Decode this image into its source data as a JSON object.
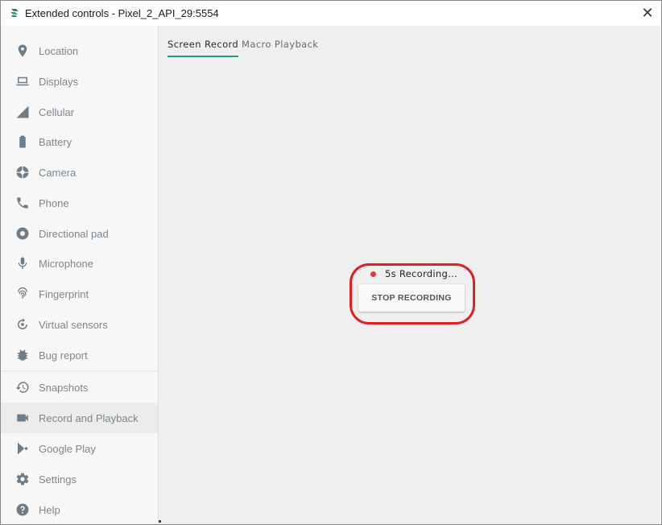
{
  "window": {
    "title": "Extended controls - Pixel_2_API_29:5554",
    "close_glyph": "✕"
  },
  "sidebar": {
    "items": [
      {
        "label": "Location",
        "icon": "location-pin-icon"
      },
      {
        "label": "Displays",
        "icon": "laptop-icon"
      },
      {
        "label": "Cellular",
        "icon": "signal-icon"
      },
      {
        "label": "Battery",
        "icon": "battery-icon"
      },
      {
        "label": "Camera",
        "icon": "camera-aperture-icon"
      },
      {
        "label": "Phone",
        "icon": "phone-icon"
      },
      {
        "label": "Directional pad",
        "icon": "dpad-icon"
      },
      {
        "label": "Microphone",
        "icon": "microphone-icon"
      },
      {
        "label": "Fingerprint",
        "icon": "fingerprint-icon"
      },
      {
        "label": "Virtual sensors",
        "icon": "rotate-sensor-icon"
      },
      {
        "label": "Bug report",
        "icon": "bug-icon"
      },
      {
        "label": "Snapshots",
        "icon": "history-icon"
      },
      {
        "label": "Record and Playback",
        "icon": "videocam-icon",
        "active": true
      },
      {
        "label": "Google Play",
        "icon": "play-store-icon"
      },
      {
        "label": "Settings",
        "icon": "gear-icon"
      },
      {
        "label": "Help",
        "icon": "help-icon"
      }
    ]
  },
  "main": {
    "tabs": [
      {
        "label": "Screen Record",
        "active": true
      },
      {
        "label": "Macro Playback",
        "active": false
      }
    ],
    "recording_status": "5s Recording...",
    "stop_button_label": "STOP RECORDING"
  },
  "colors": {
    "accent": "#16a085",
    "recording_dot": "#e53935",
    "highlight_ring": "#e01e24"
  }
}
